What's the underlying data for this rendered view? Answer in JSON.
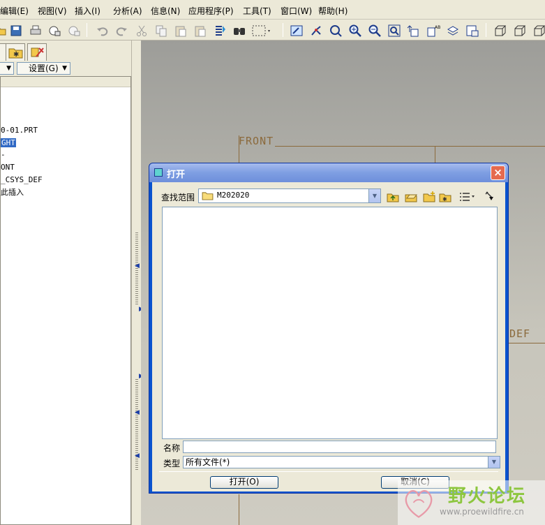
{
  "menubar": {
    "items": [
      "编辑(E)",
      "视图(V)",
      "插入(I)",
      "分析(A)",
      "信息(N)",
      "应用程序(P)",
      "工具(T)",
      "窗口(W)",
      "帮助(H)"
    ]
  },
  "left_panel": {
    "settings_label": "设置(G)",
    "tree_items": [
      "0-01.PRT",
      "GHT",
      "-",
      "ONT",
      "_CSYS_DEF",
      "此插入"
    ]
  },
  "viewport": {
    "labels": [
      "FRONT",
      "DEF"
    ],
    "colors": {
      "datum": "#8b6a3c"
    }
  },
  "dialog": {
    "title": "打开",
    "look_in_label": "查找范围",
    "look_in_value": "M202020",
    "name_label": "名称",
    "name_value": "",
    "type_label": "类型",
    "type_value": "所有文件(*)",
    "open_button": "打开(O)",
    "cancel_button": "取消(C)"
  },
  "watermark": {
    "text": "野火论坛",
    "url": "www.proewildfire.cn"
  }
}
